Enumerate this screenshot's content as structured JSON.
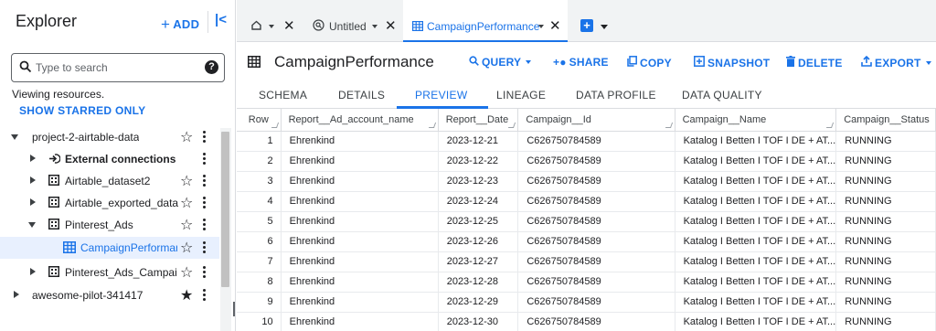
{
  "explorer": {
    "title": "Explorer",
    "add_label": "ADD",
    "collapse_glyph": "|<",
    "search_placeholder": "Type to search",
    "viewing_text": "Viewing resources.",
    "show_starred_label": "SHOW STARRED ONLY",
    "tree": [
      {
        "label": "project-2-airtable-data",
        "icon": "none",
        "arrow": "down",
        "star": "outline",
        "kebab": true
      },
      {
        "label": "External connections",
        "icon": "external-connection-icon",
        "arrow": "right",
        "star": "none",
        "kebab": true
      },
      {
        "label": "Airtable_dataset2",
        "icon": "dataset-icon",
        "arrow": "right",
        "star": "outline",
        "kebab": true
      },
      {
        "label": "Airtable_exported_data",
        "icon": "dataset-icon",
        "arrow": "right",
        "star": "outline",
        "kebab": true
      },
      {
        "label": "Pinterest_Ads",
        "icon": "dataset-icon",
        "arrow": "down",
        "star": "outline",
        "kebab": true
      },
      {
        "label": "CampaignPerforman...",
        "icon": "table-icon",
        "arrow": "none",
        "star": "outline",
        "kebab": true,
        "selected": true
      },
      {
        "label": "Pinterest_Ads_Campaig...",
        "icon": "dataset-icon",
        "arrow": "right",
        "star": "outline",
        "kebab": true
      },
      {
        "label": "awesome-pilot-341417",
        "icon": "none",
        "arrow": "right",
        "star": "filled",
        "kebab": true
      }
    ]
  },
  "tabs": {
    "home_label": "",
    "untitled_label": "Untitled",
    "active_label": "CampaignPerformance"
  },
  "page": {
    "title": "CampaignPerformance",
    "actions": {
      "query": "QUERY",
      "share": "SHARE",
      "copy": "COPY",
      "snapshot": "SNAPSHOT",
      "delete": "DELETE",
      "export": "EXPORT"
    },
    "subtabs": [
      "SCHEMA",
      "DETAILS",
      "PREVIEW",
      "LINEAGE",
      "DATA PROFILE",
      "DATA QUALITY"
    ],
    "active_subtab": "PREVIEW"
  },
  "grid": {
    "columns": [
      "Row",
      "Report__Ad_account_name",
      "Report__Date",
      "Campaign__Id",
      "Campaign__Name",
      "Campaign__Status"
    ],
    "rows": [
      [
        "1",
        "Ehrenkind",
        "2023-12-21",
        "C626750784589",
        "Katalog I Betten I TOF I DE + AT...",
        "RUNNING"
      ],
      [
        "2",
        "Ehrenkind",
        "2023-12-22",
        "C626750784589",
        "Katalog I Betten I TOF I DE + AT...",
        "RUNNING"
      ],
      [
        "3",
        "Ehrenkind",
        "2023-12-23",
        "C626750784589",
        "Katalog I Betten I TOF I DE + AT...",
        "RUNNING"
      ],
      [
        "4",
        "Ehrenkind",
        "2023-12-24",
        "C626750784589",
        "Katalog I Betten I TOF I DE + AT...",
        "RUNNING"
      ],
      [
        "5",
        "Ehrenkind",
        "2023-12-25",
        "C626750784589",
        "Katalog I Betten I TOF I DE + AT...",
        "RUNNING"
      ],
      [
        "6",
        "Ehrenkind",
        "2023-12-26",
        "C626750784589",
        "Katalog I Betten I TOF I DE + AT...",
        "RUNNING"
      ],
      [
        "7",
        "Ehrenkind",
        "2023-12-27",
        "C626750784589",
        "Katalog I Betten I TOF I DE + AT...",
        "RUNNING"
      ],
      [
        "8",
        "Ehrenkind",
        "2023-12-28",
        "C626750784589",
        "Katalog I Betten I TOF I DE + AT...",
        "RUNNING"
      ],
      [
        "9",
        "Ehrenkind",
        "2023-12-29",
        "C626750784589",
        "Katalog I Betten I TOF I DE + AT...",
        "RUNNING"
      ],
      [
        "10",
        "Ehrenkind",
        "2023-12-30",
        "C626750784589",
        "Katalog I Betten I TOF I DE + AT...",
        "RUNNING"
      ]
    ]
  },
  "colors": {
    "accent": "#1a73e8",
    "selected_bg": "#e8f0fe",
    "border": "#dadce0",
    "tabbar_bg": "#f1f3f4"
  }
}
